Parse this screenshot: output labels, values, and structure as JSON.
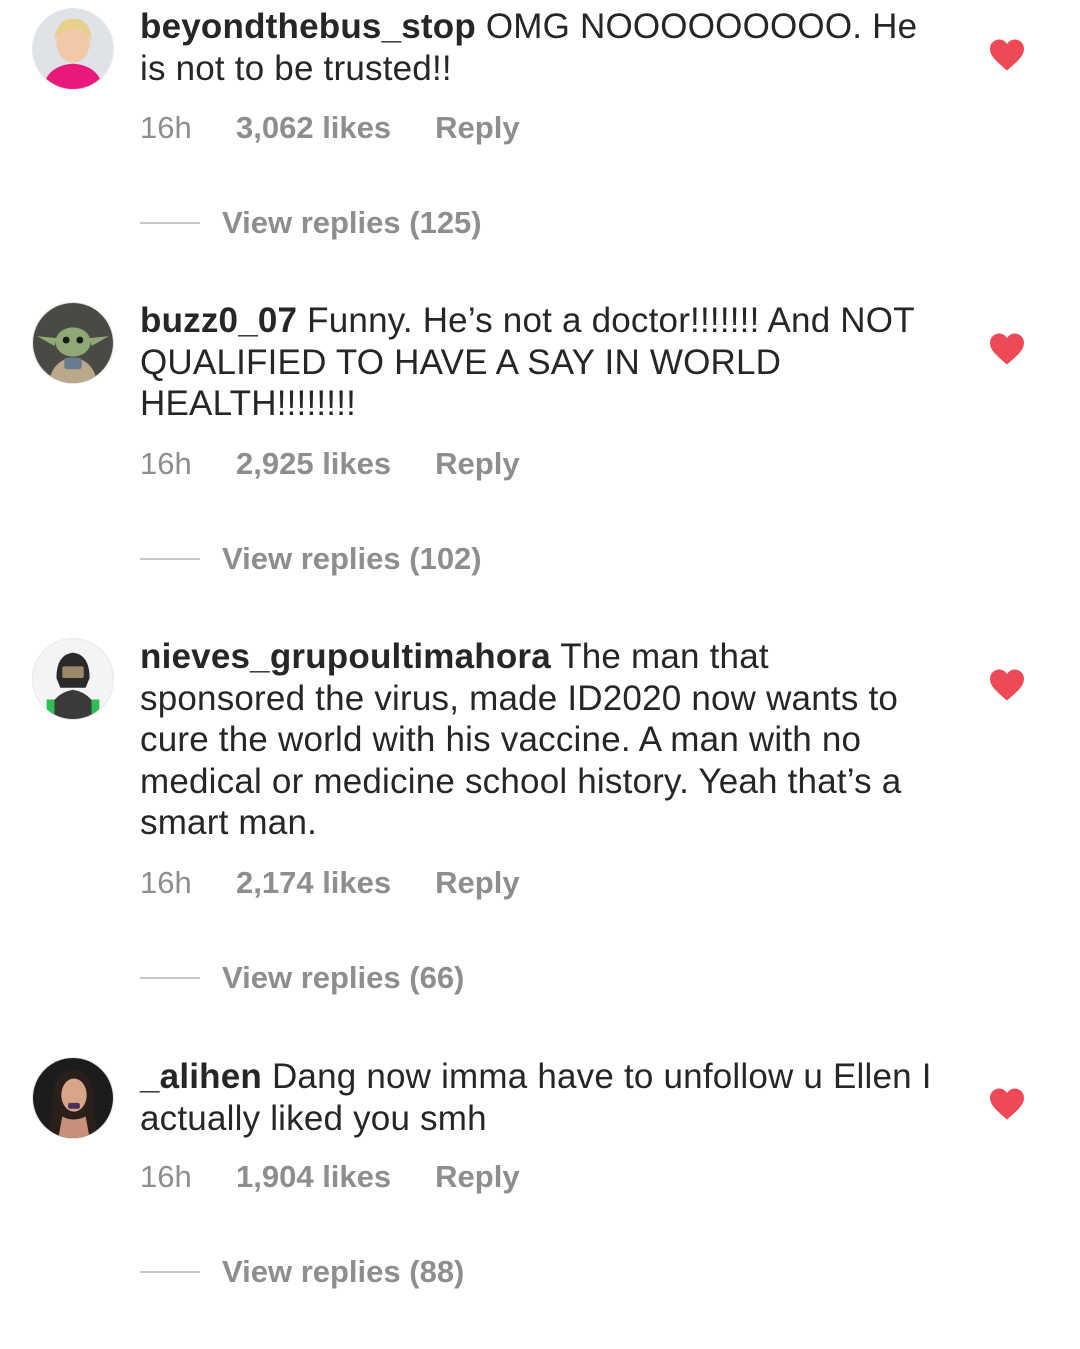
{
  "comments": [
    {
      "username": "beyondthebus_stop",
      "text": "OMG NOOOOOOOOO. He is not to be trusted!!",
      "time": "16h",
      "likes": "3,062 likes",
      "reply": "Reply",
      "view_replies": "View replies (125)",
      "liked": true
    },
    {
      "username": "buzz0_07",
      "text": "Funny. He’s not a doctor!!!!!!! And NOT QUALIFIED TO HAVE A SAY IN WORLD HEALTH!!!!!!!!",
      "time": "16h",
      "likes": "2,925 likes",
      "reply": "Reply",
      "view_replies": "View replies (102)",
      "liked": true
    },
    {
      "username": "nieves_grupoultimahora",
      "text": "The man that sponsored the virus, made ID2020 now wants to cure the world with his vaccine. A man with no medical or medicine school history. Yeah that’s a smart man.",
      "time": "16h",
      "likes": "2,174 likes",
      "reply": "Reply",
      "view_replies": "View replies (66)",
      "liked": true
    },
    {
      "username": "_alihen",
      "text": "Dang now imma have to unfollow u Ellen I actually liked you smh",
      "time": "16h",
      "likes": "1,904 likes",
      "reply": "Reply",
      "view_replies": "View replies (88)",
      "liked": true
    }
  ],
  "colors": {
    "heart": "#ed4956",
    "text": "#262626",
    "meta": "#8e8e8e"
  },
  "icons": {
    "like": "heart-filled-icon"
  }
}
